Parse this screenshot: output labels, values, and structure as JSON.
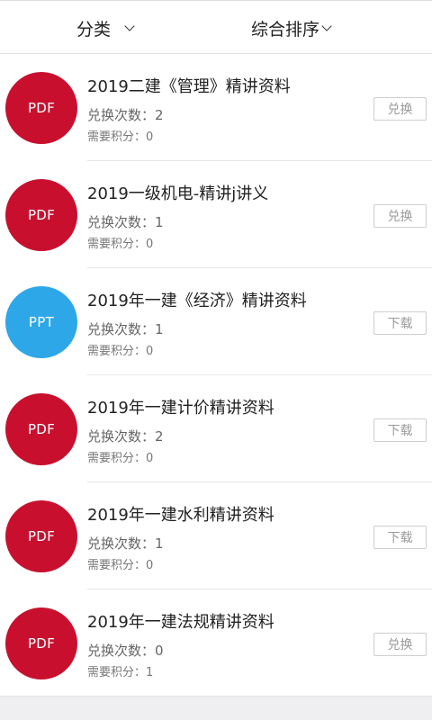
{
  "filters": {
    "category_label": "分类",
    "sort_label": "综合排序"
  },
  "items": [
    {
      "file_type": "PDF",
      "title": "2019二建《管理》精讲资料",
      "count_label": "兑换次数：",
      "count": "2",
      "points_label": "需要积分：",
      "points": "0",
      "action": "兑换"
    },
    {
      "file_type": "PDF",
      "title": "2019一级机电-精讲j讲义",
      "count_label": "兑换次数：",
      "count": "1",
      "points_label": "需要积分：",
      "points": "0",
      "action": "兑换"
    },
    {
      "file_type": "PPT",
      "title": "2019年一建《经济》精讲资料",
      "count_label": "兑换次数：",
      "count": "1",
      "points_label": "需要积分：",
      "points": "0",
      "action": "下载"
    },
    {
      "file_type": "PDF",
      "title": "2019年一建计价精讲资料",
      "count_label": "兑换次数：",
      "count": "2",
      "points_label": "需要积分：",
      "points": "0",
      "action": "下载"
    },
    {
      "file_type": "PDF",
      "title": "2019年一建水利精讲资料",
      "count_label": "兑换次数：",
      "count": "1",
      "points_label": "需要积分：",
      "points": "0",
      "action": "下载"
    },
    {
      "file_type": "PDF",
      "title": "2019年一建法规精讲资料",
      "count_label": "兑换次数：",
      "count": "0",
      "points_label": "需要积分：",
      "points": "1",
      "action": "兑换"
    }
  ],
  "colors": {
    "pdf": "#c8102e",
    "ppt": "#2ea7e8"
  }
}
